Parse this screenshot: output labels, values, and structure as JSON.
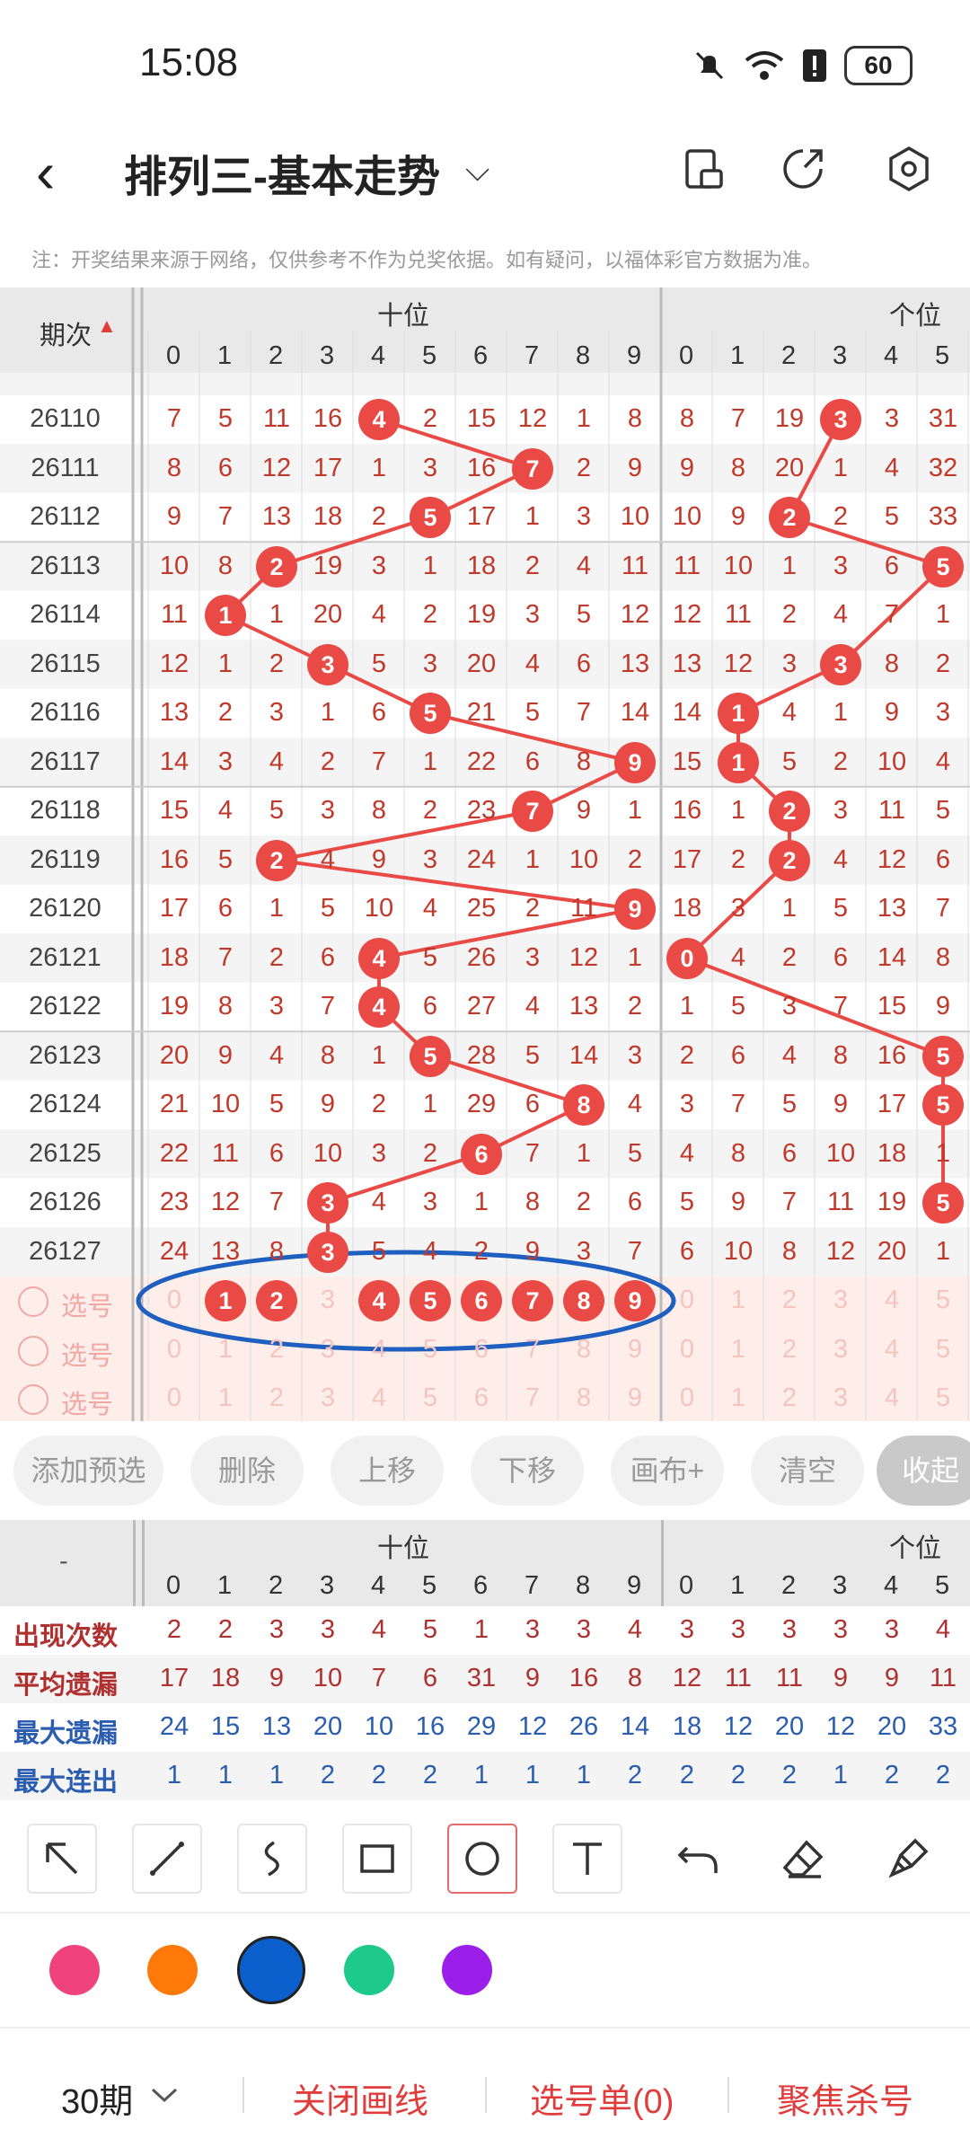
{
  "status": {
    "time": "15:08",
    "battery": "60"
  },
  "header": {
    "title": "排列三-基本走势",
    "caret": "⌵"
  },
  "note": "注：开奖结果来源于网络，仅供参考不作为兑奖依据。如有疑问，以福体彩官方数据为准。",
  "table": {
    "period_header": "期次",
    "group_tens": "十位",
    "group_units": "个位",
    "digits": [
      "0",
      "1",
      "2",
      "3",
      "4",
      "5",
      "6",
      "7",
      "8",
      "9"
    ],
    "units_digits": [
      "0",
      "1",
      "2",
      "3",
      "4",
      "5"
    ],
    "rows": [
      {
        "period": "26110",
        "tens": [
          "7",
          "5",
          "11",
          "16",
          "4",
          "2",
          "15",
          "12",
          "1",
          "8"
        ],
        "tens_hit": 4,
        "units": [
          "8",
          "7",
          "19",
          "3",
          "3",
          "31"
        ],
        "units_hit": 3
      },
      {
        "period": "26111",
        "tens": [
          "8",
          "6",
          "12",
          "17",
          "1",
          "3",
          "16",
          "7",
          "2",
          "9"
        ],
        "tens_hit": 7,
        "units": [
          "9",
          "8",
          "20",
          "1",
          "4",
          "32"
        ],
        "units_hit": -1
      },
      {
        "period": "26112",
        "tens": [
          "9",
          "7",
          "13",
          "18",
          "2",
          "5",
          "17",
          "1",
          "3",
          "10"
        ],
        "tens_hit": 5,
        "units": [
          "10",
          "9",
          "2",
          "2",
          "5",
          "33"
        ],
        "units_hit": 2
      },
      {
        "period": "26113",
        "tens": [
          "10",
          "8",
          "2",
          "19",
          "3",
          "1",
          "18",
          "2",
          "4",
          "11"
        ],
        "tens_hit": 2,
        "units": [
          "11",
          "10",
          "1",
          "3",
          "6",
          "5"
        ],
        "units_hit": 5
      },
      {
        "period": "26114",
        "tens": [
          "11",
          "1",
          "1",
          "20",
          "4",
          "2",
          "19",
          "3",
          "5",
          "12"
        ],
        "tens_hit": 1,
        "units": [
          "12",
          "11",
          "2",
          "4",
          "7",
          "1"
        ],
        "units_hit": -1
      },
      {
        "period": "26115",
        "tens": [
          "12",
          "1",
          "2",
          "3",
          "5",
          "3",
          "20",
          "4",
          "6",
          "13"
        ],
        "tens_hit": 3,
        "units": [
          "13",
          "12",
          "3",
          "3",
          "8",
          "2"
        ],
        "units_hit": 3
      },
      {
        "period": "26116",
        "tens": [
          "13",
          "2",
          "3",
          "1",
          "6",
          "5",
          "21",
          "5",
          "7",
          "14"
        ],
        "tens_hit": 5,
        "units": [
          "14",
          "1",
          "4",
          "1",
          "9",
          "3"
        ],
        "units_hit": 1
      },
      {
        "period": "26117",
        "tens": [
          "14",
          "3",
          "4",
          "2",
          "7",
          "1",
          "22",
          "6",
          "8",
          "9"
        ],
        "tens_hit": 9,
        "units": [
          "15",
          "1",
          "5",
          "2",
          "10",
          "4"
        ],
        "units_hit": 1
      },
      {
        "period": "26118",
        "tens": [
          "15",
          "4",
          "5",
          "3",
          "8",
          "2",
          "23",
          "7",
          "9",
          "1"
        ],
        "tens_hit": 7,
        "units": [
          "16",
          "1",
          "2",
          "3",
          "11",
          "5"
        ],
        "units_hit": 2
      },
      {
        "period": "26119",
        "tens": [
          "16",
          "5",
          "2",
          "4",
          "9",
          "3",
          "24",
          "1",
          "10",
          "2"
        ],
        "tens_hit": 2,
        "units": [
          "17",
          "2",
          "2",
          "4",
          "12",
          "6"
        ],
        "units_hit": 2
      },
      {
        "period": "26120",
        "tens": [
          "17",
          "6",
          "1",
          "5",
          "10",
          "4",
          "25",
          "2",
          "11",
          "9"
        ],
        "tens_hit": 9,
        "units": [
          "18",
          "3",
          "1",
          "5",
          "13",
          "7"
        ],
        "units_hit": -1
      },
      {
        "period": "26121",
        "tens": [
          "18",
          "7",
          "2",
          "6",
          "4",
          "5",
          "26",
          "3",
          "12",
          "1"
        ],
        "tens_hit": 4,
        "units": [
          "0",
          "4",
          "2",
          "6",
          "14",
          "8"
        ],
        "units_hit": 0
      },
      {
        "period": "26122",
        "tens": [
          "19",
          "8",
          "3",
          "7",
          "4",
          "6",
          "27",
          "4",
          "13",
          "2"
        ],
        "tens_hit": 4,
        "units": [
          "1",
          "5",
          "3",
          "7",
          "15",
          "9"
        ],
        "units_hit": -1
      },
      {
        "period": "26123",
        "tens": [
          "20",
          "9",
          "4",
          "8",
          "1",
          "5",
          "28",
          "5",
          "14",
          "3"
        ],
        "tens_hit": 5,
        "units": [
          "2",
          "6",
          "4",
          "8",
          "16",
          "5"
        ],
        "units_hit": 5
      },
      {
        "period": "26124",
        "tens": [
          "21",
          "10",
          "5",
          "9",
          "2",
          "1",
          "29",
          "6",
          "8",
          "4"
        ],
        "tens_hit": 8,
        "units": [
          "3",
          "7",
          "5",
          "9",
          "17",
          "5"
        ],
        "units_hit": 5
      },
      {
        "period": "26125",
        "tens": [
          "22",
          "11",
          "6",
          "10",
          "3",
          "2",
          "6",
          "7",
          "1",
          "5"
        ],
        "tens_hit": 6,
        "units": [
          "4",
          "8",
          "6",
          "10",
          "18",
          "1"
        ],
        "units_hit": -1
      },
      {
        "period": "26126",
        "tens": [
          "23",
          "12",
          "7",
          "3",
          "4",
          "3",
          "1",
          "8",
          "2",
          "6"
        ],
        "tens_hit": 3,
        "units": [
          "5",
          "9",
          "7",
          "11",
          "19",
          "5"
        ],
        "units_hit": 5
      },
      {
        "period": "26127",
        "tens": [
          "24",
          "13",
          "8",
          "3",
          "5",
          "4",
          "2",
          "9",
          "3",
          "7"
        ],
        "tens_hit": 3,
        "units": [
          "6",
          "10",
          "8",
          "12",
          "20",
          "1"
        ],
        "units_hit": -1
      }
    ],
    "select_label": "选号",
    "selected_tens": [
      "1",
      "2",
      "4",
      "5",
      "6",
      "7",
      "8",
      "9"
    ]
  },
  "buttons": [
    "添加预选",
    "删除",
    "上移",
    "下移",
    "画布+",
    "清空",
    "收起"
  ],
  "stats": {
    "dash": "-",
    "rows": [
      {
        "label": "出现次数",
        "color": "#b03030",
        "tens": [
          "2",
          "2",
          "3",
          "3",
          "4",
          "5",
          "1",
          "3",
          "3",
          "4"
        ],
        "units": [
          "3",
          "3",
          "3",
          "3",
          "3",
          "4"
        ]
      },
      {
        "label": "平均遗漏",
        "color": "#b03030",
        "tens": [
          "17",
          "18",
          "9",
          "10",
          "7",
          "6",
          "31",
          "9",
          "16",
          "8"
        ],
        "units": [
          "12",
          "11",
          "11",
          "9",
          "9",
          "11"
        ]
      },
      {
        "label": "最大遗漏",
        "color": "#2a5db0",
        "tens": [
          "24",
          "15",
          "13",
          "20",
          "10",
          "16",
          "29",
          "12",
          "26",
          "14"
        ],
        "units": [
          "18",
          "12",
          "20",
          "12",
          "20",
          "33"
        ]
      },
      {
        "label": "最大连出",
        "color": "#2a5db0",
        "tens": [
          "1",
          "1",
          "1",
          "2",
          "2",
          "2",
          "1",
          "1",
          "1",
          "2"
        ],
        "units": [
          "2",
          "2",
          "2",
          "1",
          "2",
          "2"
        ]
      }
    ]
  },
  "palette": [
    "#f0437e",
    "#ff7a0a",
    "#0a5fcc",
    "#1ec98c",
    "#9b1fe8"
  ],
  "bottom": {
    "periods": "30期",
    "close_lines": "关闭画线",
    "selection_list": "选号单(0)",
    "focus_kill": "聚焦杀号"
  }
}
